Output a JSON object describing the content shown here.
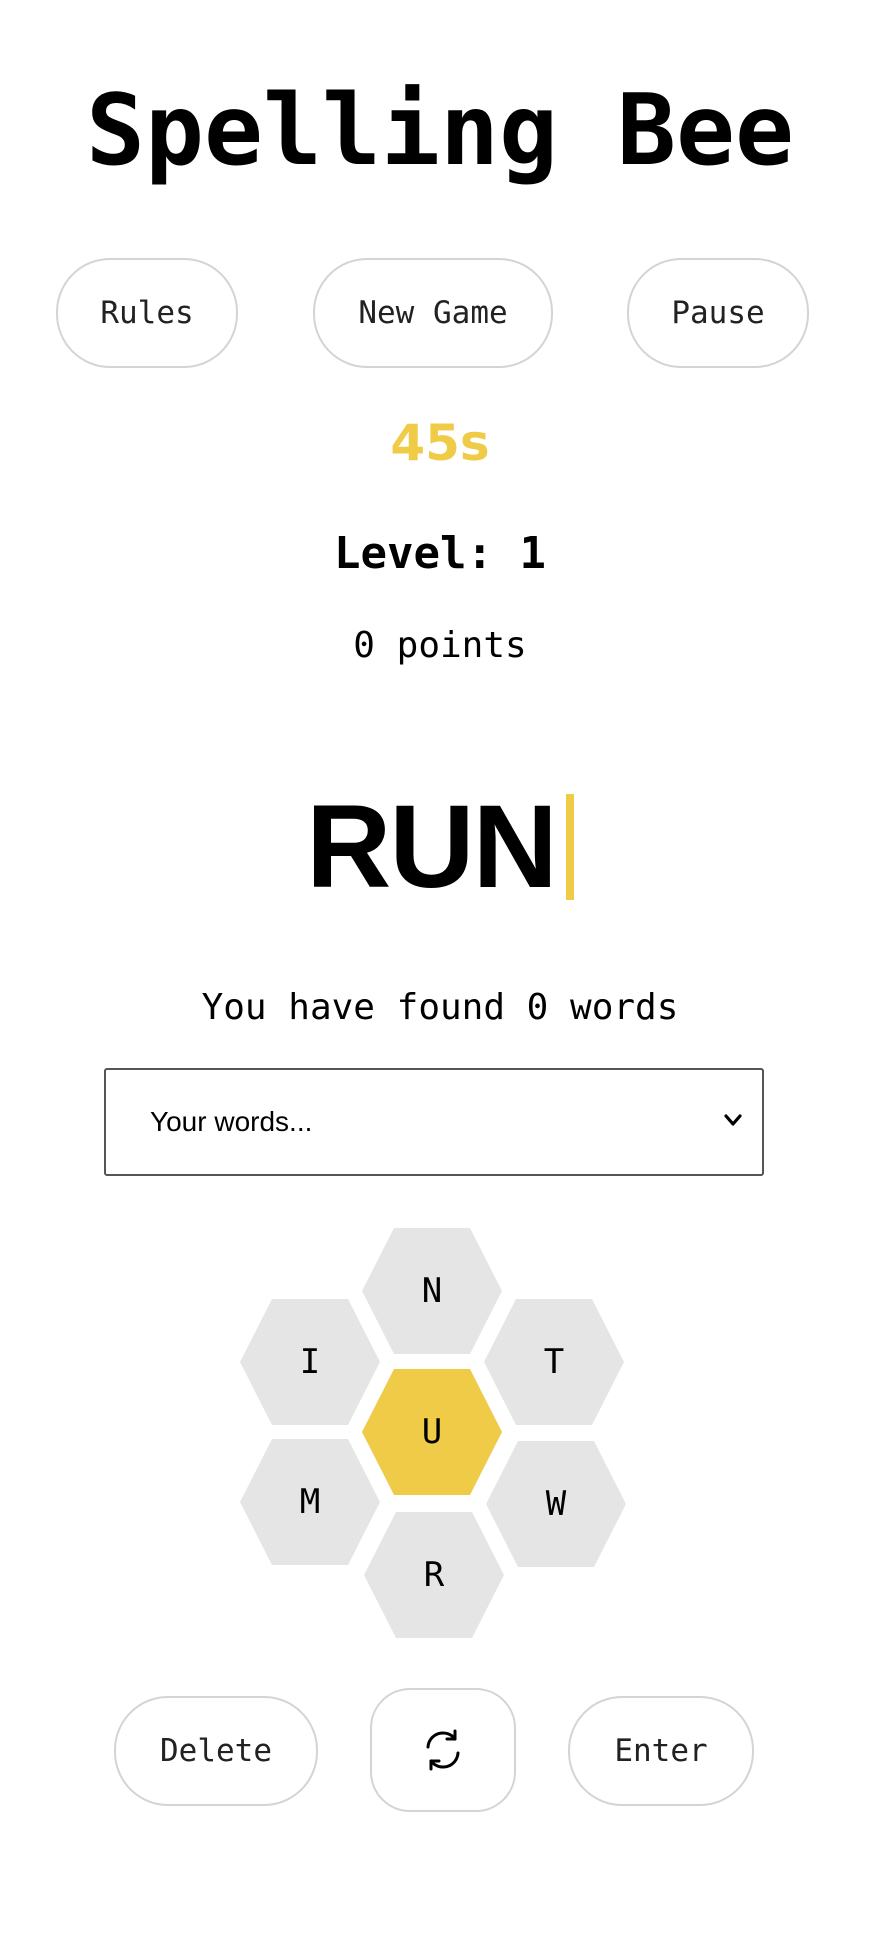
{
  "title": "Spelling Bee",
  "buttons": {
    "rules": "Rules",
    "new_game": "New Game",
    "pause": "Pause",
    "delete": "Delete",
    "enter": "Enter",
    "shuffle_icon": "refresh-icon"
  },
  "timer": "45s",
  "level": "Level: 1",
  "points": "0 points",
  "current_word": "RUN",
  "found_text": "You have found 0 words",
  "words_select": {
    "selected": "Your words...",
    "options": [
      "Your words..."
    ]
  },
  "hive": {
    "center_letter": "U",
    "outer_letters": {
      "top": "N",
      "upper_left": "I",
      "upper_right": "T",
      "lower_left": "M",
      "lower_right": "W",
      "bottom": "R"
    }
  },
  "colors": {
    "accent": "#efcb48",
    "hex_outer": "#e5e5e5",
    "border": "#d4d4d4"
  }
}
